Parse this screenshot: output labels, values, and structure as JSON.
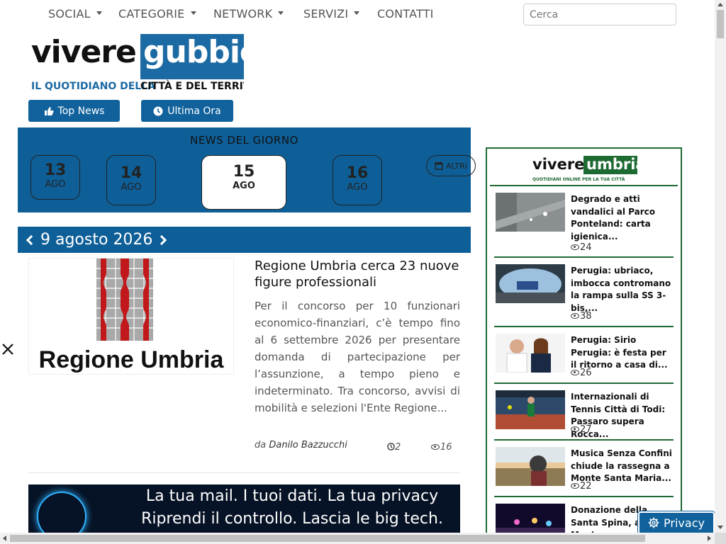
{
  "nav": {
    "items": [
      {
        "label": "SOCIAL",
        "dropdown": true
      },
      {
        "label": "CATEGORIE",
        "dropdown": true
      },
      {
        "label": "NETWORK",
        "dropdown": true
      },
      {
        "label": "SERVIZI",
        "dropdown": true
      },
      {
        "label": "CONTATTI",
        "dropdown": false
      }
    ],
    "search_placeholder": "Cerca"
  },
  "logo": {
    "word_left": "vivere",
    "word_right": "gubbio",
    "tagline_left": "IL QUOTIDIANO DELLA",
    "tagline_right": "CITTÀ E DEL TERRITORIO"
  },
  "buttons": {
    "top_news": "Top News",
    "ultima_ora": "Ultima Ora"
  },
  "news_day": {
    "title": "NEWS DEL GIORNO",
    "days": [
      {
        "num": "13",
        "month": "AGO"
      },
      {
        "num": "14",
        "month": "AGO"
      },
      {
        "num": "15",
        "month": "AGO",
        "active": true
      },
      {
        "num": "16",
        "month": "AGO"
      }
    ],
    "altri": "ALTRI"
  },
  "date_bar": "9 agosto 2026",
  "article": {
    "image_caption": "Regione Umbria",
    "title": "Regione Umbria cerca 23 nuove figure professionali",
    "body": "Per il concorso per 10 funzionari economico-finanziari, c’è tempo fino al 6 settembre 2026 per presentare domanda di partecipazione per l’assunzione, a tempo pieno e indeterminato. Tra concorso, avvisi di mobilità e selezioni l'Ente Regione...",
    "by": "da",
    "author": "Danilo Bazzucchi",
    "comments": "2",
    "views": "16"
  },
  "banner": {
    "line1": "La tua mail.  I tuoi dati.  La tua privacy",
    "line2": "Riprendi il controllo. Lascia le big tech."
  },
  "sidebar": {
    "logo_left": "vivere",
    "logo_right": "umbria",
    "logo_tagline": "QUOTIDIANI ONLINE PER LA TUA CITTÀ",
    "items": [
      {
        "title": "Degrado e atti vandalici al Parco Ponteland: carta igienica...",
        "views": "24"
      },
      {
        "title": "Perugia: ubriaco, imbocca contromano la rampa sulla SS 3-bis,...",
        "views": "38"
      },
      {
        "title": "Perugia: Sirio Perugia: è festa per il ritorno a casa di...",
        "views": "26"
      },
      {
        "title": "Internazionali di Tennis Città di Todi: Passaro supera Rocca...",
        "views": "27"
      },
      {
        "title": "Musica Senza Confini chiude la rassegna a Monte Santa Maria...",
        "views": "22"
      },
      {
        "title": "Donazione della Santa Spina, a Montone proseguono le...",
        "views": ""
      }
    ]
  },
  "privacy": "Privacy",
  "colors": {
    "primary_blue": "#0e5f98",
    "sidebar_green": "#1e6a33",
    "umbria_red": "#c0181b"
  }
}
